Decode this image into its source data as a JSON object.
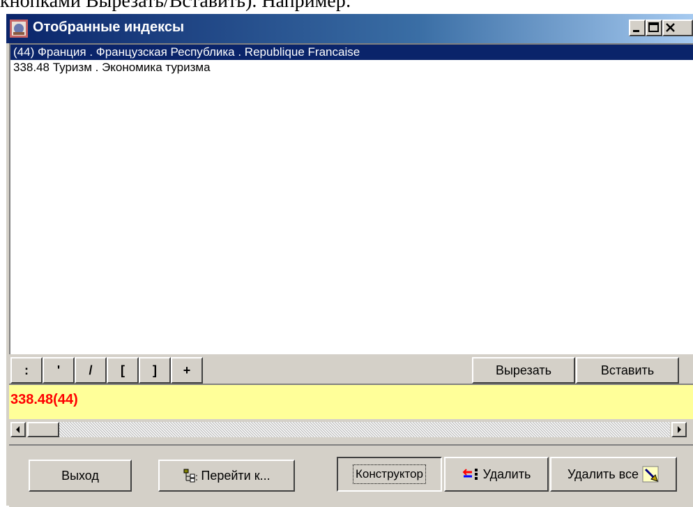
{
  "background_text": "кнопками Вырезать/Вставить). Например:",
  "window": {
    "title": "Отобранные индексы",
    "icon": "app-icon",
    "controls": {
      "minimize": "minimize-icon",
      "maximize": "maximize-icon",
      "close": "close-icon"
    }
  },
  "list": {
    "items": [
      {
        "label": "(44) Франция . Французская Республика . Republique Francaise",
        "selected": true
      },
      {
        "label": "338.48 Туризм . Экономика туризма",
        "selected": false
      }
    ]
  },
  "toolbar": {
    "symbols": [
      ":",
      "'",
      "/",
      "[",
      "]",
      "+"
    ],
    "cut_label": "Вырезать",
    "paste_label": "Вставить"
  },
  "formula": {
    "value": "338.48(44)",
    "color": "#ff0000",
    "background": "#ffff99"
  },
  "actions": {
    "exit_label": "Выход",
    "goto_label": "Перейти к...",
    "constructor_label": "Конструктор",
    "delete_label": "Удалить",
    "delete_all_label": "Удалить все"
  },
  "colors": {
    "title_bar": "#0a246a",
    "selection": "#0a246a",
    "face": "#d4d0c8"
  }
}
